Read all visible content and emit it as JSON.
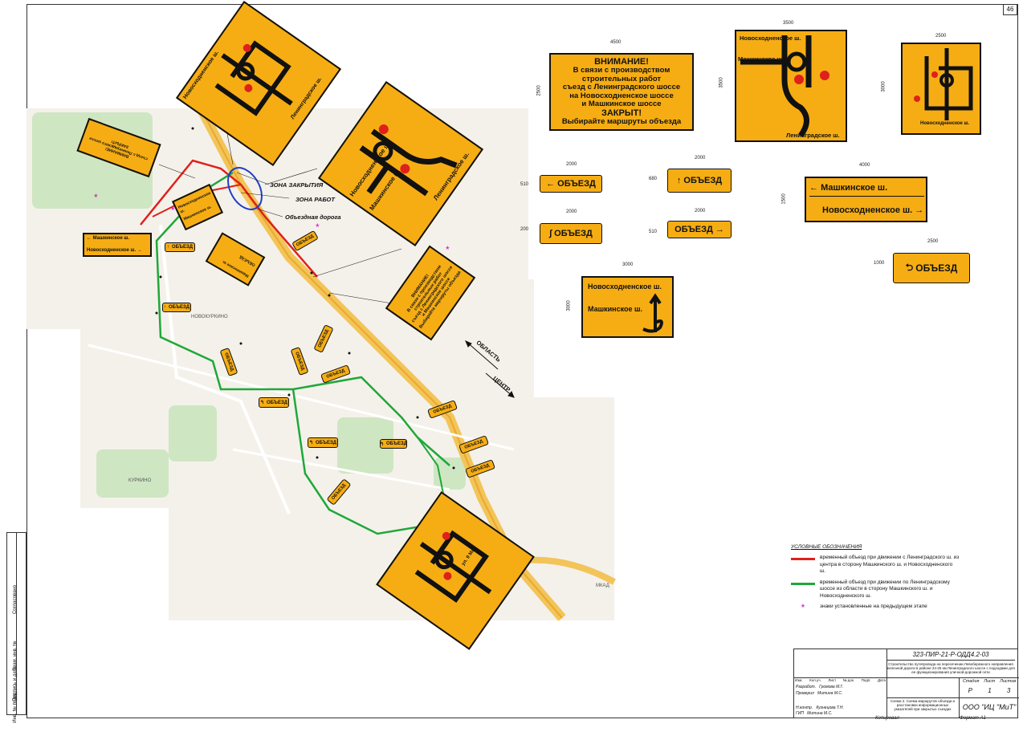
{
  "sheet_number": "46",
  "zone_labels": {
    "closure": "ЗОНА ЗАКРЫТИЯ",
    "works": "ЗОНА РАБОТ",
    "bypass": "Объездная дорога"
  },
  "directions": {
    "region": "ОБЛАСТЬ",
    "center": "ЦЕНТР"
  },
  "map_labels": {
    "novokurkino": "НОВОКУРКИНО",
    "kurkino": "КУРКИНО",
    "fimki": "ФИМКИ",
    "mkad": "МКАД"
  },
  "roads": {
    "leningradskoe": "Ленинградское ш.",
    "novoskhodnenskoe": "Новосходненское ш.",
    "mashkinskoe": "Машкинское ш.",
    "ul_9_maya": "ул. 9 Мая"
  },
  "warning": {
    "l1": "ВНИМАНИЕ!",
    "l2": "В связи с производством",
    "l3": "строительных работ",
    "l4": "съезд с Ленинградского шоссе",
    "l5": "на Новосходненское шоссе",
    "l6": "и Машкинское шоссе",
    "l7": "ЗАКРЫТ!",
    "l8": "Выбирайте маршруты объезда"
  },
  "detour_word": "ОБЪЕЗД",
  "dimensions": {
    "w4500": "4500",
    "h2500": "2500",
    "w3500": "3500",
    "h3500": "3500",
    "w2500": "2500",
    "h3000": "3000",
    "w2000": "2000",
    "h200": "200",
    "h510": "510",
    "h680": "680",
    "w4000": "4000",
    "h1500": "1500",
    "h1000": "1000",
    "w3000": "3000",
    "h3000b": "3000"
  },
  "legend": {
    "title": "УСЛОВНЫЕ ОБОЗНАЧЕНИЯ",
    "red": "временный объезд при движении с Ленинградского ш. из центра в сторону Машкинского ш. и Новосходненского ш.",
    "green": "временный объезд при движении по Ленинградскому шоссе из области в сторону Машкинского ш. и Новосходненского ш.",
    "star": "знаки установленные на предыдущем этапе",
    "red_color": "#e0201b",
    "green_color": "#1fa83a",
    "star_color": "#d400d4"
  },
  "title_block": {
    "code": "323-ПИР-21-Р-ОДД4.2-03",
    "description": "Строительство путепровода на пересечении Левобережного направления железной дороги в районе 24-25 км Ленинградского шоссе с подходами для ее функционирования уличной-дорожной сети",
    "sheet_title": "Схема 2. Схема маршрутов объезда и расстановки информационных указателей при закрытых съездах",
    "stage_h": "Стадия",
    "sheet_h": "Лист",
    "sheets_h": "Листов",
    "stage": "Р",
    "sheet": "1",
    "sheets": "3",
    "org": "ООО \"ИЦ \"МиТ\"",
    "cols": [
      "Изм.",
      "Кол.уч.",
      "Лист",
      "№ док.",
      "Подп.",
      "Дата"
    ],
    "roles": [
      "Разработ.",
      "Проверил",
      "Н.контр.",
      "ГИП"
    ],
    "names": [
      "Громова М.Г.",
      "Митина М.С.",
      "Кузнецова Т.Н.",
      "Митина М.С."
    ],
    "copy": "Копировал",
    "format": "Формат А1"
  },
  "side_strip": [
    "Согласовано",
    "Взам. инв. №",
    "Подпись и дата",
    "Инв. № подл."
  ]
}
